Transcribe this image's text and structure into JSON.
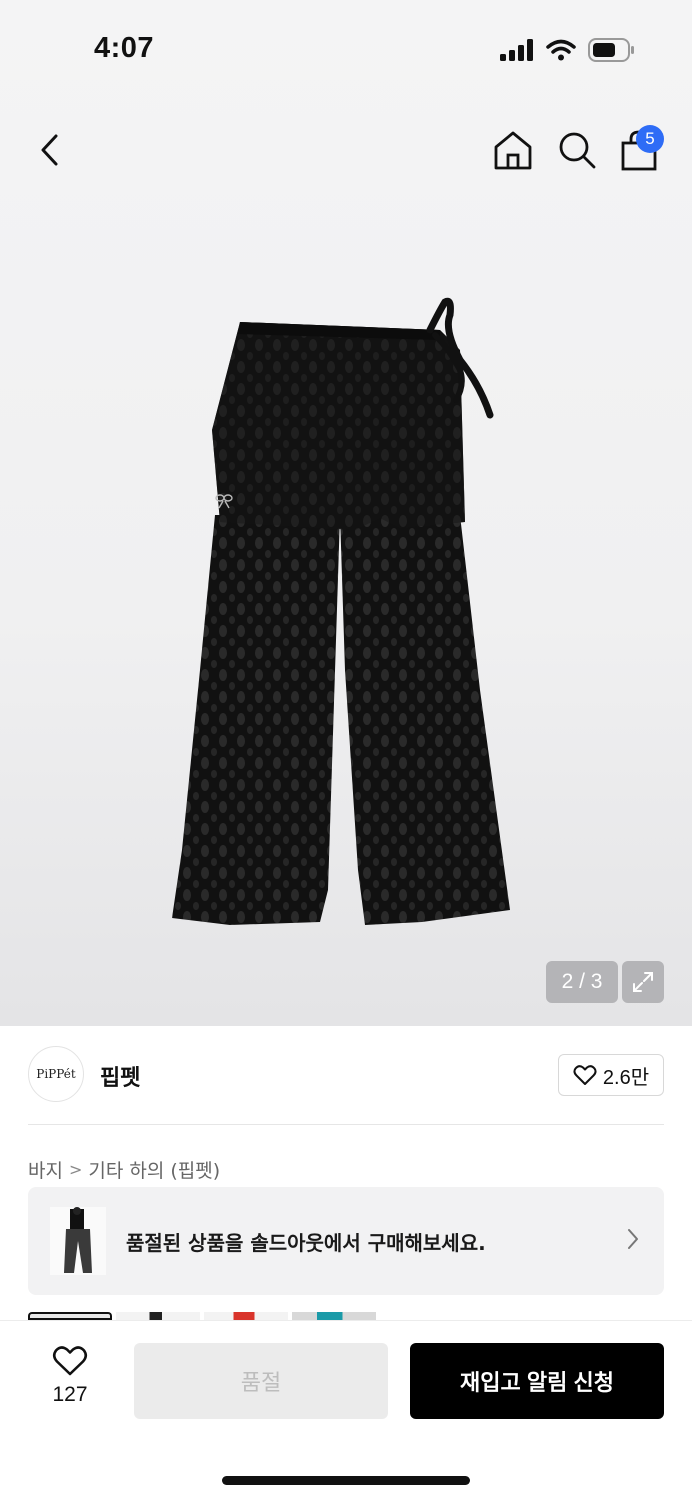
{
  "status_bar": {
    "time": "4:07"
  },
  "nav": {
    "cart_count": "5"
  },
  "gallery": {
    "pager": "2 / 3"
  },
  "brand": {
    "logo_text": "PiPPét",
    "name": "핍펫",
    "likes": "2.6만"
  },
  "breadcrumb": {
    "category": "바지",
    "separator": ">",
    "subcategory": "기타 하의 (핍펫)"
  },
  "banner": {
    "text": "품절된 상품을 솔드아웃에서 구매해보세요."
  },
  "bottom_bar": {
    "wish_count": "127",
    "soldout_label": "품절",
    "restock_label": "재입고 알림 신청"
  },
  "colors": {
    "badge": "#2e6cf6",
    "primary_button": "#000000",
    "disabled_button": "#ebebeb"
  }
}
